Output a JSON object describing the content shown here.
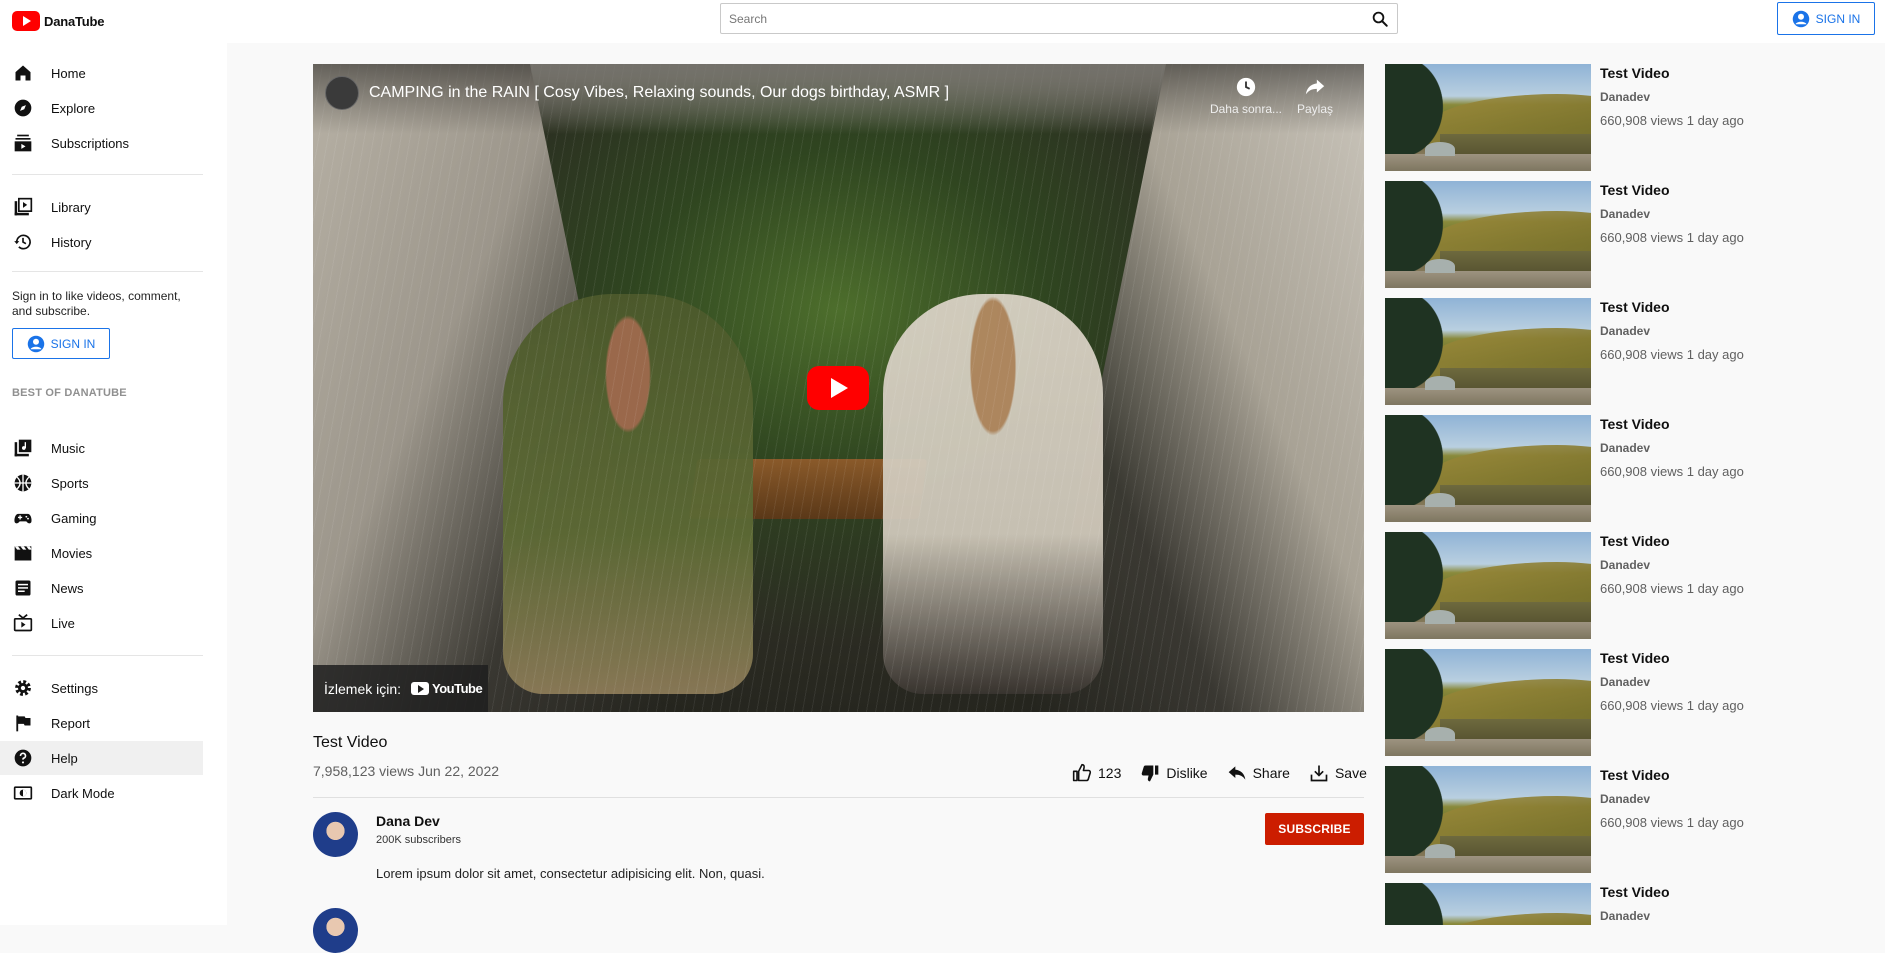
{
  "app": {
    "name": "DanaTube",
    "brand_color": "#ff0000",
    "accent_color": "#1a73e8"
  },
  "search": {
    "placeholder": "Search",
    "icon": "search-icon"
  },
  "header": {
    "signin_label": "SIGN IN"
  },
  "sidebar": {
    "primary": [
      {
        "label": "Home",
        "icon": "home-icon"
      },
      {
        "label": "Explore",
        "icon": "compass-icon"
      },
      {
        "label": "Subscriptions",
        "icon": "subscriptions-icon"
      }
    ],
    "library": [
      {
        "label": "Library",
        "icon": "library-icon"
      },
      {
        "label": "History",
        "icon": "history-icon"
      }
    ],
    "signin_note": "Sign in to like videos, comment, and subscribe.",
    "signin_label": "SIGN IN",
    "best_title": "BEST OF DANATUBE",
    "best": [
      {
        "label": "Music",
        "icon": "music-icon"
      },
      {
        "label": "Sports",
        "icon": "sports-icon"
      },
      {
        "label": "Gaming",
        "icon": "gaming-icon"
      },
      {
        "label": "Movies",
        "icon": "movies-icon"
      },
      {
        "label": "News",
        "icon": "news-icon"
      },
      {
        "label": "Live",
        "icon": "live-icon"
      }
    ],
    "bottom": [
      {
        "label": "Settings",
        "icon": "settings-icon"
      },
      {
        "label": "Report",
        "icon": "flag-icon"
      },
      {
        "label": "Help",
        "icon": "help-icon",
        "active": true
      },
      {
        "label": "Dark Mode",
        "icon": "dark-mode-icon"
      }
    ]
  },
  "player": {
    "embed_title": "CAMPING in the RAIN [ Cosy Vibes, Relaxing sounds, Our dogs birthday, ASMR ]",
    "watch_later_label": "Daha sonra...",
    "share_label": "Paylaş",
    "watch_on_label": "İzlemek için:",
    "youtube_label": "YouTube"
  },
  "video": {
    "title": "Test Video",
    "meta": "7,958,123 views Jun 22, 2022",
    "like_count": "123",
    "dislike_label": "Dislike",
    "share_label": "Share",
    "save_label": "Save"
  },
  "channel": {
    "name": "Dana Dev",
    "subscribers": "200K subscribers",
    "subscribe_label": "SUBSCRIBE",
    "description": "Lorem ipsum dolor sit amet, consectetur adipisicing elit. Non, quasi."
  },
  "recommendations": [
    {
      "title": "Test Video",
      "channel": "Danadev",
      "meta": "660,908 views 1 day ago"
    },
    {
      "title": "Test Video",
      "channel": "Danadev",
      "meta": "660,908 views 1 day ago"
    },
    {
      "title": "Test Video",
      "channel": "Danadev",
      "meta": "660,908 views 1 day ago"
    },
    {
      "title": "Test Video",
      "channel": "Danadev",
      "meta": "660,908 views 1 day ago"
    },
    {
      "title": "Test Video",
      "channel": "Danadev",
      "meta": "660,908 views 1 day ago"
    },
    {
      "title": "Test Video",
      "channel": "Danadev",
      "meta": "660,908 views 1 day ago"
    },
    {
      "title": "Test Video",
      "channel": "Danadev",
      "meta": "660,908 views 1 day ago"
    },
    {
      "title": "Test Video",
      "channel": "Danadev",
      "meta": ""
    }
  ]
}
